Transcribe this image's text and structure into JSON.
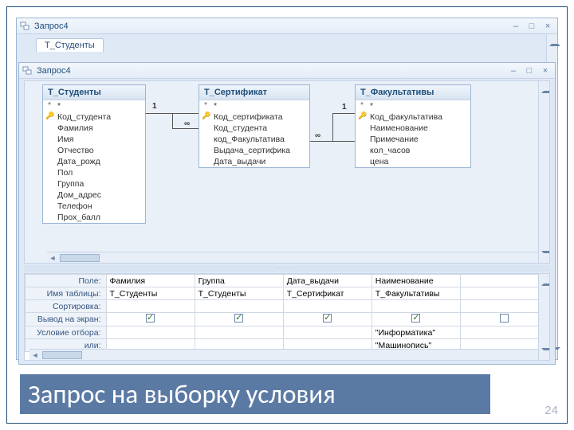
{
  "back_window": {
    "title": "Запрос4",
    "tab": "Т_Студенты"
  },
  "front_window": {
    "title": "Запрос4"
  },
  "tables": {
    "students": {
      "title": "Т_Студенты",
      "fields": [
        "*",
        "Код_студента",
        "Фамилия",
        "Имя",
        "Отчество",
        "Дата_рожд",
        "Пол",
        "Группа",
        "Дом_адрес",
        "Телефон",
        "Прох_балл"
      ]
    },
    "cert": {
      "title": "Т_Сертификат",
      "fields": [
        "*",
        "Код_сертификата",
        "Код_студента",
        "код_Факультатива",
        "Выдача_сертифика",
        "Дата_выдачи"
      ]
    },
    "elect": {
      "title": "Т_Факультативы",
      "fields": [
        "*",
        "Код_факультатива",
        "Наименование",
        "Примечание",
        "кол_часов",
        "цена"
      ]
    }
  },
  "relations": {
    "one_a": "1",
    "many_a": "∞",
    "one_b": "1",
    "many_b": "∞"
  },
  "grid": {
    "rows": {
      "field": "Поле:",
      "table": "Имя таблицы:",
      "sort": "Сортировка:",
      "show": "Вывод на экран:",
      "criteria": "Условие отбора:",
      "or": "или:"
    },
    "cols": [
      {
        "field": "Фамилия",
        "table": "Т_Студенты",
        "show": true,
        "criteria": "",
        "or": ""
      },
      {
        "field": "Группа",
        "table": "Т_Студенты",
        "show": true,
        "criteria": "",
        "or": ""
      },
      {
        "field": "Дата_выдачи",
        "table": "Т_Сертификат",
        "show": true,
        "criteria": "",
        "or": ""
      },
      {
        "field": "Наименование",
        "table": "Т_Факультативы",
        "show": true,
        "criteria": "\"Информатика\"",
        "or": "\"Машинопись\""
      },
      {
        "field": "",
        "table": "",
        "show": false,
        "criteria": "",
        "or": ""
      }
    ]
  },
  "caption": "Запрос на выборку условия",
  "page": "24"
}
